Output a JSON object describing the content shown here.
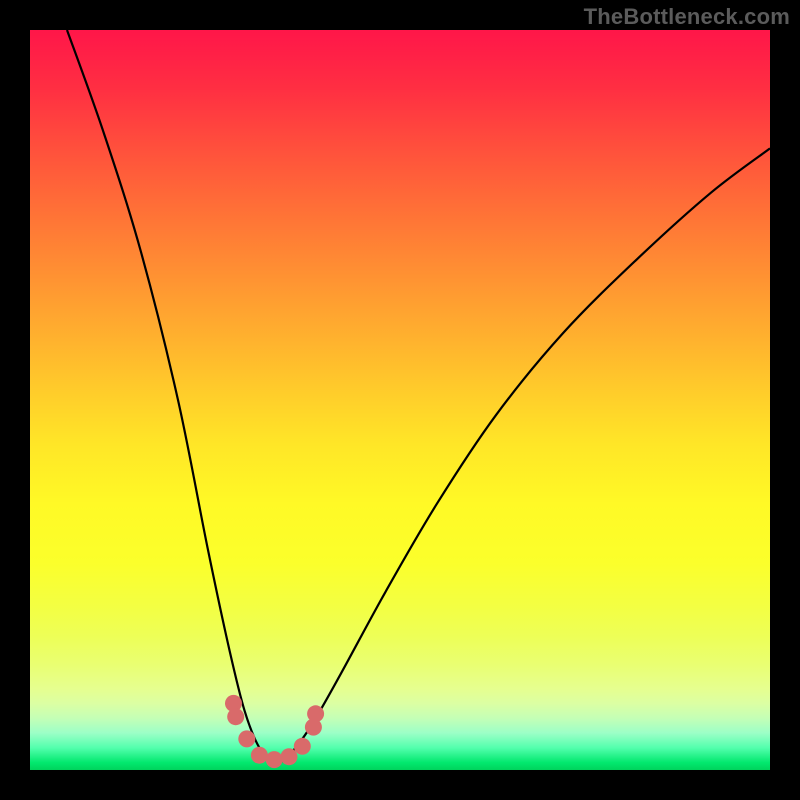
{
  "watermark": "TheBottleneck.com",
  "colors": {
    "frame_bg": "#000000",
    "marker_fill": "#d96a6a",
    "gradient_top": "#ff1649",
    "gradient_mid": "#ffe627",
    "gradient_bottom": "#00d35c"
  },
  "chart_data": {
    "type": "line",
    "title": "",
    "xlabel": "",
    "ylabel": "",
    "x_range": [
      0,
      100
    ],
    "y_range": [
      0,
      100
    ],
    "grid": false,
    "legend": false,
    "note": "Axes are not labeled; x and y are normalized 0–100. Curve represents a bottleneck/mismatch metric that dips to ~0 near x≈33 and rises steeply on either side. Values estimated from pixel positions.",
    "series": [
      {
        "name": "bottleneck-curve",
        "x": [
          5,
          10,
          15,
          20,
          24,
          27,
          29,
          31,
          33,
          35,
          38,
          42,
          48,
          55,
          63,
          72,
          82,
          92,
          100
        ],
        "y": [
          100,
          86,
          70,
          50,
          30,
          16,
          8,
          3,
          1,
          2,
          6,
          13,
          24,
          36,
          48,
          59,
          69,
          78,
          84
        ]
      }
    ],
    "markers": {
      "name": "highlight-points",
      "x": [
        27.5,
        27.8,
        29.3,
        31.0,
        33.0,
        35.0,
        36.8,
        38.3,
        38.6
      ],
      "y": [
        9.0,
        7.2,
        4.2,
        2.0,
        1.4,
        1.8,
        3.2,
        5.8,
        7.6
      ]
    }
  }
}
